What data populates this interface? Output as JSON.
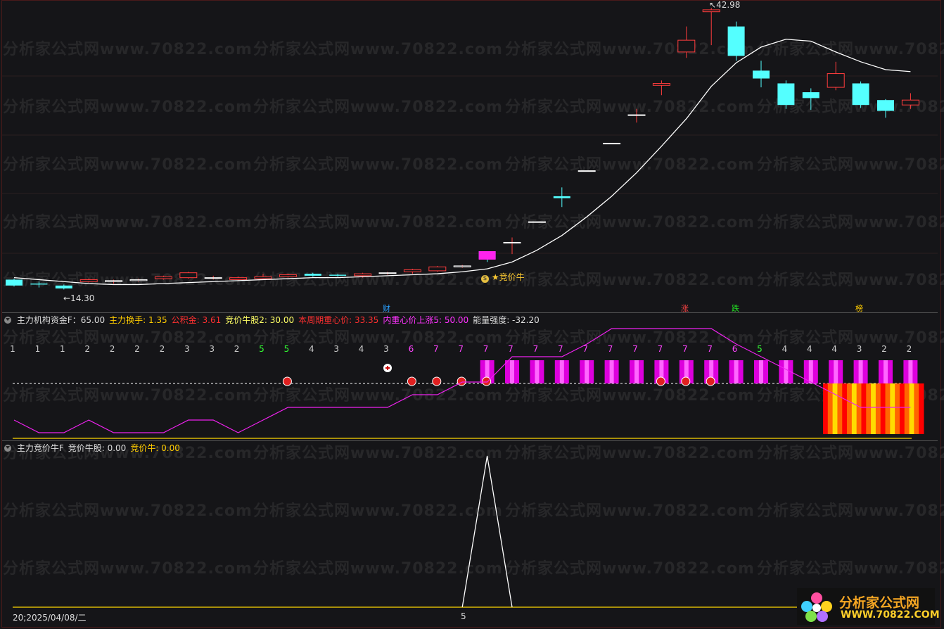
{
  "watermark": "分析家公式网www.70822.com",
  "main_chart": {
    "high_label": "42.98",
    "low_label": "14.30",
    "signal_label": "竞价牛",
    "markers": [
      {
        "text": "财",
        "color": "#2aa0ff"
      },
      {
        "text": "涨",
        "color": "#ff4444"
      },
      {
        "text": "跌",
        "color": "#22dd22"
      },
      {
        "text": "榜",
        "color": "#ffcc00"
      }
    ]
  },
  "panel1": {
    "title": "主力机构资金F",
    "values": [
      {
        "text": "主力机构资金F：65.00",
        "color": "#dddddd"
      },
      {
        "text": "主力换手: 1.35",
        "color": "#ffcc00"
      },
      {
        "text": "公积金: 3.61",
        "color": "#ff3030"
      },
      {
        "text": "竞价牛股2: 30.00",
        "color": "#ffff66"
      },
      {
        "text": "本周期重心价: 33.35",
        "color": "#ff3030"
      },
      {
        "text": "内重心价上涨5: 50.00",
        "color": "#ff33ff"
      },
      {
        "text": "能量强度: -32.20",
        "color": "#dddddd"
      }
    ],
    "day_counts": [
      "1",
      "1",
      "1",
      "2",
      "2",
      "2",
      "2",
      "3",
      "3",
      "2",
      "5",
      "5",
      "4",
      "3",
      "4",
      "3",
      "6",
      "7",
      "7",
      "7",
      "7",
      "7",
      "7",
      "7",
      "7",
      "7",
      "7",
      "7",
      "7",
      "6",
      "5",
      "4",
      "4",
      "4",
      "3",
      "2",
      "2"
    ]
  },
  "panel2": {
    "values": [
      {
        "text": "主力竞价牛F",
        "color": "#dddddd"
      },
      {
        "text": "竞价牛股: 0.00",
        "color": "#dddddd"
      },
      {
        "text": "竞价牛: 0.00",
        "color": "#ffcc00"
      }
    ]
  },
  "x_axis": {
    "date": "20;2025/04/08/二",
    "tick_5": "5"
  },
  "logo": {
    "title": "分析家公式网",
    "url": "WWW.70822.COM"
  },
  "colors": {
    "up": "#ff3d3d",
    "down": "#54ffff",
    "ma": "#ffffff",
    "magenta": "#ff00ff",
    "yellow": "#ffd800"
  }
}
